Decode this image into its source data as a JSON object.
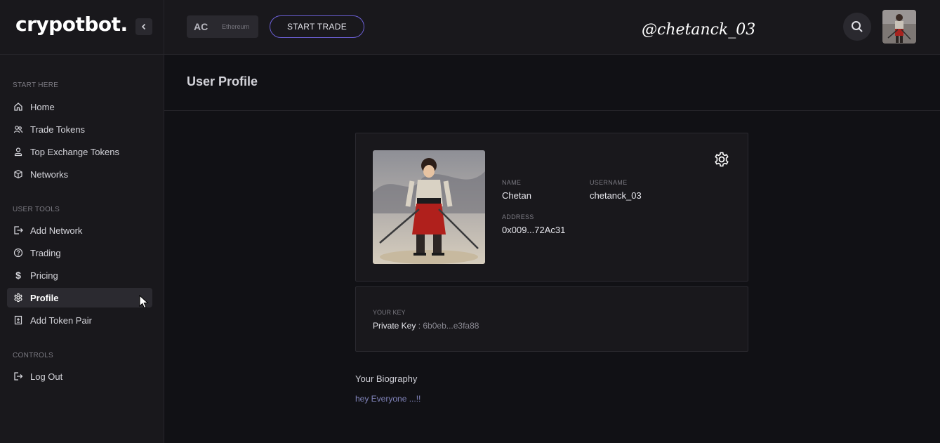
{
  "brand": {
    "logo": "crypotbot."
  },
  "topbar": {
    "chain_abbr": "AC",
    "chain_name": "Ethereum",
    "start_trade_label": "START TRADE",
    "watermark": "@chetanck_03"
  },
  "sidebar": {
    "sections": [
      {
        "title": "START HERE"
      },
      {
        "title": "USER TOOLS"
      },
      {
        "title": "CONTROLS"
      }
    ],
    "items": [
      {
        "label": "Home",
        "icon": "home-icon"
      },
      {
        "label": "Trade Tokens",
        "icon": "users-icon"
      },
      {
        "label": "Top Exchange Tokens",
        "icon": "user-icon"
      },
      {
        "label": "Networks",
        "icon": "cube-icon"
      },
      {
        "label": "Add Network",
        "icon": "login-icon"
      },
      {
        "label": "Trading",
        "icon": "help-circle-icon"
      },
      {
        "label": "Pricing",
        "icon": "dollar-icon"
      },
      {
        "label": "Profile",
        "icon": "gear-icon",
        "active": true
      },
      {
        "label": "Add Token Pair",
        "icon": "token-pair-icon"
      },
      {
        "label": "Log Out",
        "icon": "logout-icon"
      }
    ]
  },
  "main": {
    "page_title": "User Profile",
    "profile": {
      "name_label": "NAME",
      "name": "Chetan",
      "username_label": "USERNAME",
      "username": "chetanck_03",
      "address_label": "ADDRESS",
      "address": "0x009...72Ac31"
    },
    "key": {
      "section_label": "YOUR KEY",
      "title": "Private Key",
      "separator": " : ",
      "value": "6b0eb...e3fa88"
    },
    "bio": {
      "title": "Your Biography",
      "text": "hey Everyone ...!!"
    }
  },
  "colors": {
    "accent": "#6b5fd4",
    "background": "#111115",
    "panel": "#19181c"
  }
}
